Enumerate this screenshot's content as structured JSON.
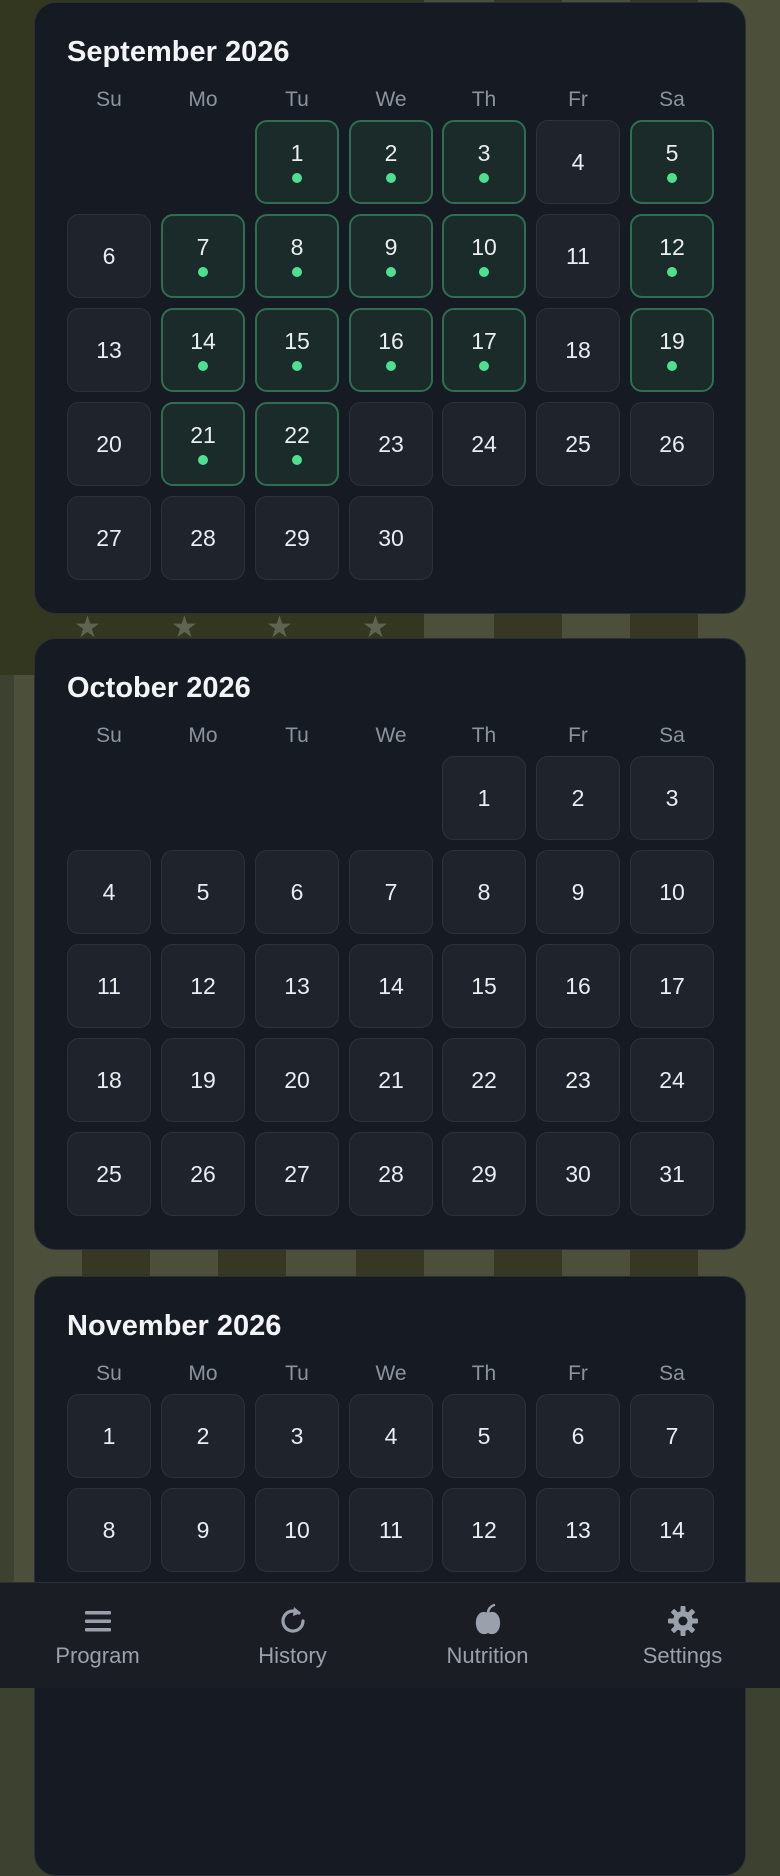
{
  "days_of_week": [
    "Su",
    "Mo",
    "Tu",
    "We",
    "Th",
    "Fr",
    "Sa"
  ],
  "colors": {
    "accent": "#4ee08f",
    "card_bg": "#161a22",
    "day_bg": "#1f232b",
    "active_border": "#2f6e52"
  },
  "months": [
    {
      "title": "September 2026",
      "first_weekday": 2,
      "days": 30,
      "active_days": [
        1,
        2,
        3,
        5,
        7,
        8,
        9,
        10,
        12,
        14,
        15,
        16,
        17,
        19,
        21,
        22
      ]
    },
    {
      "title": "October 2026",
      "first_weekday": 4,
      "days": 31,
      "active_days": []
    },
    {
      "title": "November 2026",
      "first_weekday": 0,
      "days": 14,
      "active_days": []
    }
  ],
  "nav": {
    "items": [
      {
        "label": "Program",
        "icon": "menu-icon"
      },
      {
        "label": "History",
        "icon": "history-icon"
      },
      {
        "label": "Nutrition",
        "icon": "nutrition-icon"
      },
      {
        "label": "Settings",
        "icon": "gear-icon"
      }
    ]
  }
}
